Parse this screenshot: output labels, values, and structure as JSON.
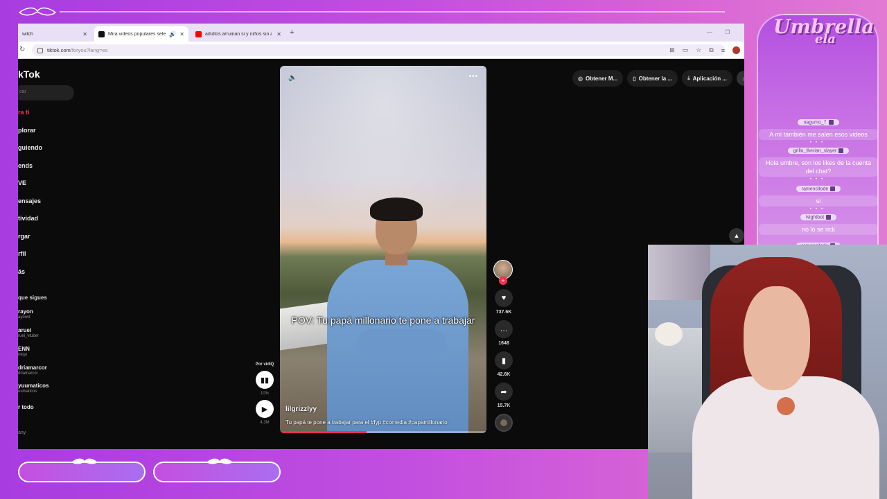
{
  "colors": {
    "brand_purple": "#b34fe0",
    "tiktok_red": "#fe2c55",
    "tiktok_bg": "#0b0b0b"
  },
  "browser": {
    "tabs": [
      {
        "label": "witch",
        "icon": "twitch-icon"
      },
      {
        "label": "Mira videos populares sele",
        "icon": "tiktok-icon",
        "active": true
      },
      {
        "label": "adultos arruinan si y niños sin a",
        "icon": "youtube-icon"
      }
    ],
    "url_host": "tiktok.com",
    "url_path": "/foryou?lang=es"
  },
  "tiktok": {
    "logo": "kTok",
    "search_placeholder": "car",
    "nav": [
      "ra ti",
      "plorar",
      "guiendo",
      "ends",
      "VE",
      "ensajes",
      "tividad",
      "rgar",
      "rfil",
      "ás"
    ],
    "following_title": "que sigues",
    "following": [
      {
        "name": "rayon",
        "handle": "ayonvt"
      },
      {
        "name": "aruei",
        "handle": "ruei_vtuber"
      },
      {
        "name": "ENN",
        "handle": "nkqu"
      },
      {
        "name": "driamarcor",
        "handle": "driamarcor"
      },
      {
        "name": "yuumaticos",
        "handle": "uumaticos"
      }
    ],
    "see_all": "r todo",
    "company": "any",
    "top_actions": [
      "Obtener M...",
      "Obtener la ...",
      "Aplicación ..."
    ],
    "video": {
      "caption": "POV: Tu papá millonario te pone a trabajar",
      "author": "lilgrizzlyy",
      "description": "Tu papá te pone a trabajar para el #fyp #comedia #papamillonario",
      "progress": 0.42
    },
    "vidiq": {
      "label": "Por vidIQ",
      "percent": "10%",
      "views": "4.3M"
    },
    "counts": {
      "likes": "737.6K",
      "comments": "1648",
      "saves": "42.6K",
      "shares": "15.7K"
    }
  },
  "chat": {
    "logo_main": "Umbrella",
    "logo_sub": "ela",
    "messages": [
      {
        "user": "nagumo_7",
        "text": "A mí también me salen esos videos"
      },
      {
        "user": "grillo_therian_slayer",
        "text": "Hola umbre, son los likes de la cuenta del chat?"
      },
      {
        "user": "ramencitode",
        "text": "si"
      },
      {
        "user": "Nightbot",
        "text": "no lo se rick"
      },
      {
        "user": "ramencitode",
        "text": ""
      }
    ]
  }
}
